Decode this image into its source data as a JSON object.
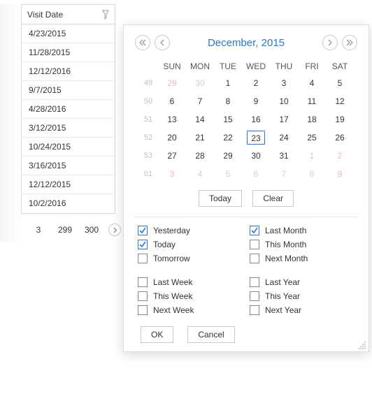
{
  "grid": {
    "header": "Visit Date",
    "rows": [
      "4/23/2015",
      "11/28/2015",
      "12/12/2016",
      "9/7/2015",
      "4/28/2016",
      "3/12/2015",
      "10/24/2015",
      "3/16/2015",
      "12/12/2015",
      "10/2/2016"
    ]
  },
  "pager": {
    "visible": [
      "3",
      "299",
      "300"
    ]
  },
  "calendar": {
    "title": "December, 2015",
    "dow": [
      "SUN",
      "MON",
      "TUE",
      "WED",
      "THU",
      "FRI",
      "SAT"
    ],
    "weeks": [
      {
        "wk": "49",
        "days": [
          {
            "n": "29",
            "cls": "out wkend"
          },
          {
            "n": "30",
            "cls": "out"
          },
          {
            "n": "1"
          },
          {
            "n": "2"
          },
          {
            "n": "3"
          },
          {
            "n": "4"
          },
          {
            "n": "5",
            "cls": "wkend"
          }
        ]
      },
      {
        "wk": "50",
        "days": [
          {
            "n": "6",
            "cls": "wkend"
          },
          {
            "n": "7"
          },
          {
            "n": "8"
          },
          {
            "n": "9"
          },
          {
            "n": "10"
          },
          {
            "n": "11"
          },
          {
            "n": "12",
            "cls": "wkend"
          }
        ]
      },
      {
        "wk": "51",
        "days": [
          {
            "n": "13",
            "cls": "wkend"
          },
          {
            "n": "14"
          },
          {
            "n": "15"
          },
          {
            "n": "16"
          },
          {
            "n": "17"
          },
          {
            "n": "18"
          },
          {
            "n": "19",
            "cls": "wkend"
          }
        ]
      },
      {
        "wk": "52",
        "days": [
          {
            "n": "20",
            "cls": "wkend"
          },
          {
            "n": "21"
          },
          {
            "n": "22"
          },
          {
            "n": "23",
            "today": true
          },
          {
            "n": "24"
          },
          {
            "n": "25"
          },
          {
            "n": "26",
            "cls": "wkend"
          }
        ]
      },
      {
        "wk": "53",
        "days": [
          {
            "n": "27",
            "cls": "wkend"
          },
          {
            "n": "28"
          },
          {
            "n": "29"
          },
          {
            "n": "30"
          },
          {
            "n": "31"
          },
          {
            "n": "1",
            "cls": "out"
          },
          {
            "n": "2",
            "cls": "out wkend"
          }
        ]
      },
      {
        "wk": "01",
        "days": [
          {
            "n": "3",
            "cls": "out wkend"
          },
          {
            "n": "4",
            "cls": "out"
          },
          {
            "n": "5",
            "cls": "out"
          },
          {
            "n": "6",
            "cls": "out"
          },
          {
            "n": "7",
            "cls": "out"
          },
          {
            "n": "8",
            "cls": "out"
          },
          {
            "n": "9",
            "cls": "out wkend"
          }
        ]
      }
    ],
    "today_btn": "Today",
    "clear_btn": "Clear"
  },
  "filters": {
    "col1": [
      {
        "id": "yesterday",
        "label": "Yesterday",
        "checked": true
      },
      {
        "id": "today",
        "label": "Today",
        "checked": true
      },
      {
        "id": "tomorrow",
        "label": "Tomorrow",
        "checked": false
      }
    ],
    "col1b": [
      {
        "id": "last-week",
        "label": "Last Week",
        "checked": false
      },
      {
        "id": "this-week",
        "label": "This Week",
        "checked": false
      },
      {
        "id": "next-week",
        "label": "Next Week",
        "checked": false
      }
    ],
    "col2": [
      {
        "id": "last-month",
        "label": "Last Month",
        "checked": true
      },
      {
        "id": "this-month",
        "label": "This Month",
        "checked": false
      },
      {
        "id": "next-month",
        "label": "Next Month",
        "checked": false
      }
    ],
    "col2b": [
      {
        "id": "last-year",
        "label": "Last Year",
        "checked": false
      },
      {
        "id": "this-year",
        "label": "This Year",
        "checked": false
      },
      {
        "id": "next-year",
        "label": "Next Year",
        "checked": false
      }
    ]
  },
  "buttons": {
    "ok": "OK",
    "cancel": "Cancel"
  }
}
